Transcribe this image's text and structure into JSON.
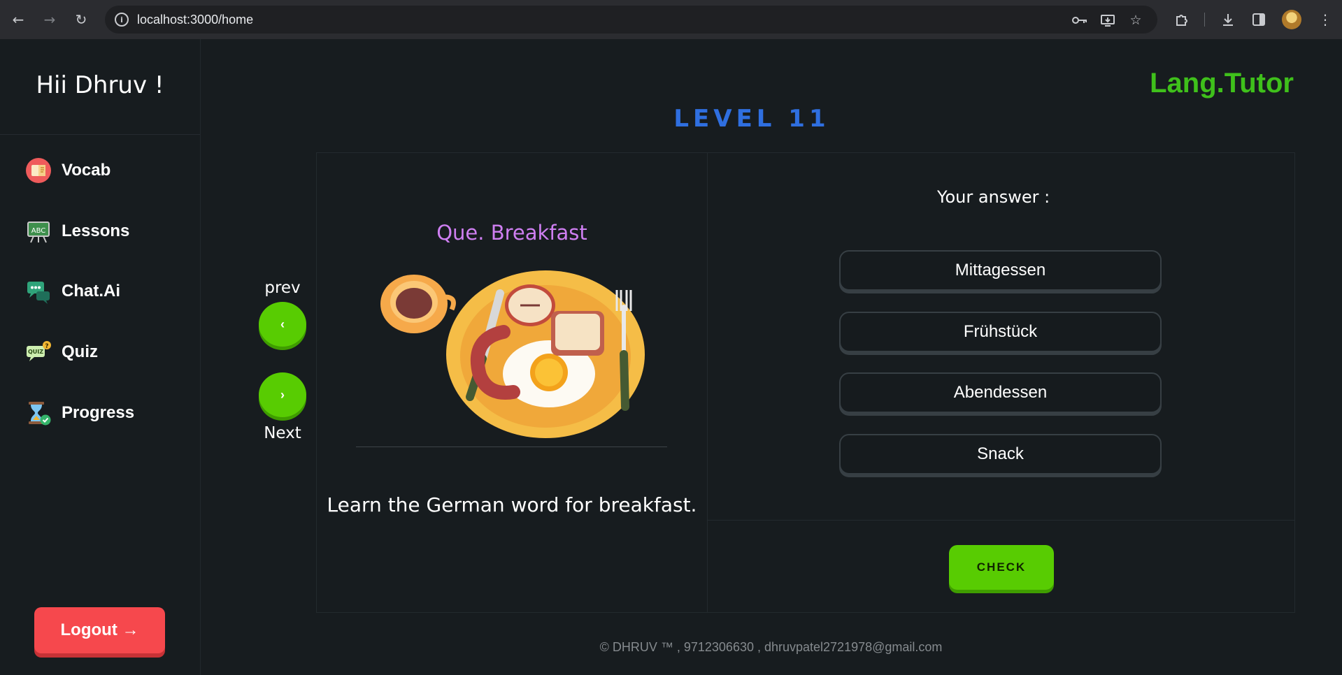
{
  "browser": {
    "url": "localhost:3000/home"
  },
  "sidebar": {
    "greeting": "Hii Dhruv !",
    "items": [
      {
        "label": "Vocab",
        "icon": "book-icon"
      },
      {
        "label": "Lessons",
        "icon": "chalkboard-icon"
      },
      {
        "label": "Chat.Ai",
        "icon": "chat-bubbles-icon"
      },
      {
        "label": "Quiz",
        "icon": "quiz-icon"
      },
      {
        "label": "Progress",
        "icon": "hourglass-check-icon"
      }
    ],
    "logout_label": "Logout →"
  },
  "header": {
    "brand": "Lang.Tutor",
    "level": "LEVEL 11"
  },
  "card": {
    "prev_label": "prev",
    "next_label": "Next",
    "question": "Que. Breakfast",
    "image_icon": "breakfast-plate-illustration",
    "hint": "Learn the German word for breakfast.",
    "answer_title": "Your answer :",
    "options": [
      "Mittagessen",
      "Frühstück",
      "Abendessen",
      "Snack"
    ],
    "check_label": "CHECK"
  },
  "footer": {
    "text": "© DHRUV ™ , 9712306630 , dhruvpatel2721978@gmail.com"
  },
  "colors": {
    "accent_green": "#58cc02",
    "brand_green": "#3fc01b",
    "level_blue": "#2f6fe0",
    "question_purple": "#cf7ff2",
    "logout_red": "#f6484d",
    "background": "#171c1f"
  }
}
